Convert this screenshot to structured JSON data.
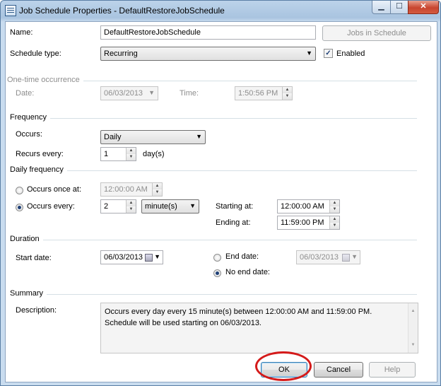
{
  "window": {
    "title": "Job Schedule Properties - DefaultRestoreJobSchedule",
    "minimize_glyph": "▁",
    "maximize_glyph": "☐",
    "close_glyph": "✕"
  },
  "general": {
    "name_label": "Name:",
    "name_value": "DefaultRestoreJobSchedule",
    "jobs_button": "Jobs in Schedule",
    "schedule_type_label": "Schedule type:",
    "schedule_type_value": "Recurring",
    "enabled_label": "Enabled",
    "enabled_checked": true
  },
  "one_time": {
    "section_label": "One-time occurrence",
    "date_label": "Date:",
    "date_value": "06/03/2013",
    "time_label": "Time:",
    "time_value": "1:50:56 PM"
  },
  "frequency": {
    "section_label": "Frequency",
    "occurs_label": "Occurs:",
    "occurs_value": "Daily",
    "recurs_label": "Recurs every:",
    "recurs_value": "1",
    "recurs_unit": "day(s)"
  },
  "daily_frequency": {
    "section_label": "Daily frequency",
    "once_label": "Occurs once at:",
    "once_value": "12:00:00 AM",
    "every_label": "Occurs every:",
    "every_value": "2",
    "every_unit": "minute(s)",
    "starting_label": "Starting at:",
    "starting_value": "12:00:00 AM",
    "ending_label": "Ending at:",
    "ending_value": "11:59:00 PM",
    "selected": "every"
  },
  "duration": {
    "section_label": "Duration",
    "start_label": "Start date:",
    "start_value": "06/03/2013",
    "end_label": "End date:",
    "end_value": "06/03/2013",
    "no_end_label": "No end date:",
    "selected": "no_end"
  },
  "summary": {
    "section_label": "Summary",
    "description_label": "Description:",
    "description_text": "Occurs every day every 15 minute(s) between 12:00:00 AM and 11:59:00 PM. Schedule will be used starting on 06/03/2013."
  },
  "buttons": {
    "ok": "OK",
    "cancel": "Cancel",
    "help": "Help"
  },
  "colors": {
    "annotation_circle": "#d41a1a",
    "title_bar": "#bcd3ea",
    "close_button": "#c8452f"
  }
}
